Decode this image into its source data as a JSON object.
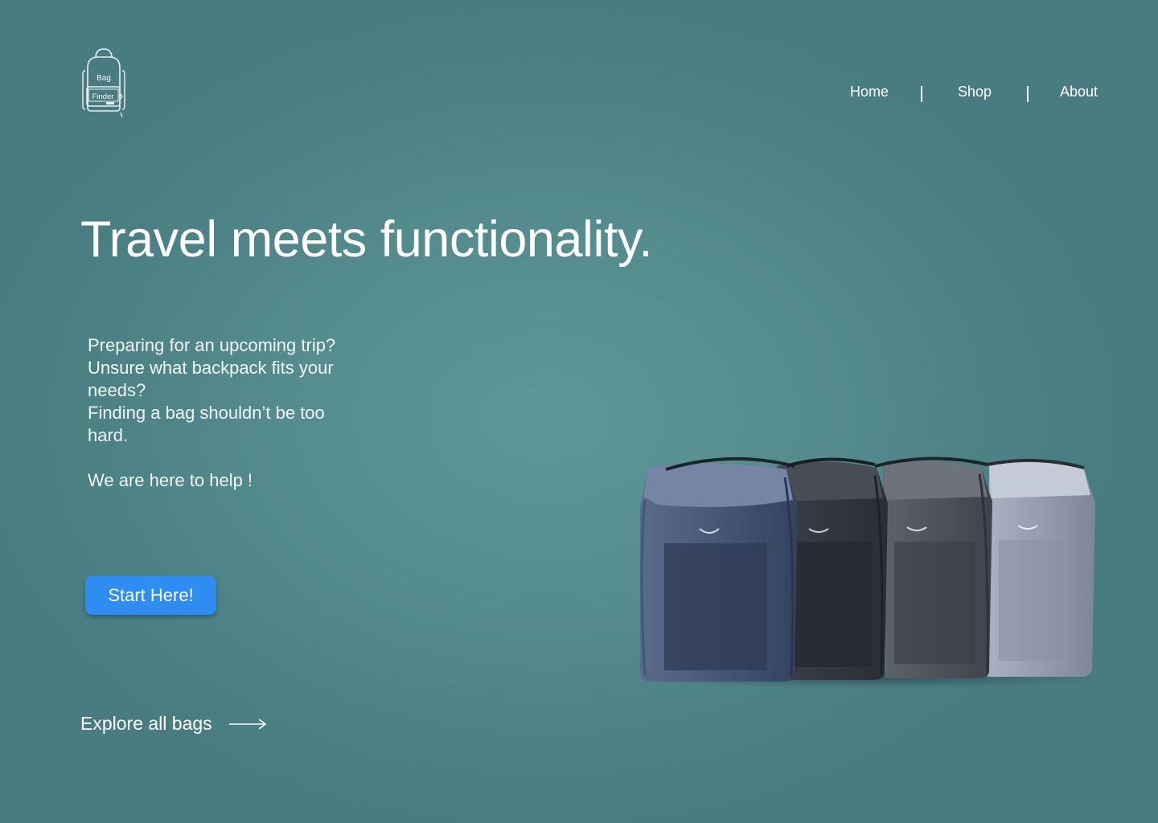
{
  "header": {
    "logo": {
      "line1": "Bag",
      "line2": "Finder"
    },
    "nav": [
      {
        "label": "Home"
      },
      {
        "label": "Shop"
      },
      {
        "label": "About"
      }
    ]
  },
  "hero": {
    "title": "Travel meets functionality.",
    "intro_lines": [
      "Preparing for an upcoming trip?",
      "Unsure what backpack fits your needs?",
      "Finding a bag shouldn’t be too hard."
    ],
    "tagline": "We are here to help !",
    "cta_label": "Start Here!",
    "explore_label": "Explore all bags"
  },
  "icons": {
    "logo": "backpack-logo-icon",
    "explore": "arrow-right-icon"
  },
  "colors": {
    "background": "#558c8e",
    "cta": "#2f8cf0",
    "text": "#ffffff",
    "bag_colors": [
      "#3c4b6c",
      "#32373f",
      "#4a4e57",
      "#8c95a6"
    ]
  }
}
